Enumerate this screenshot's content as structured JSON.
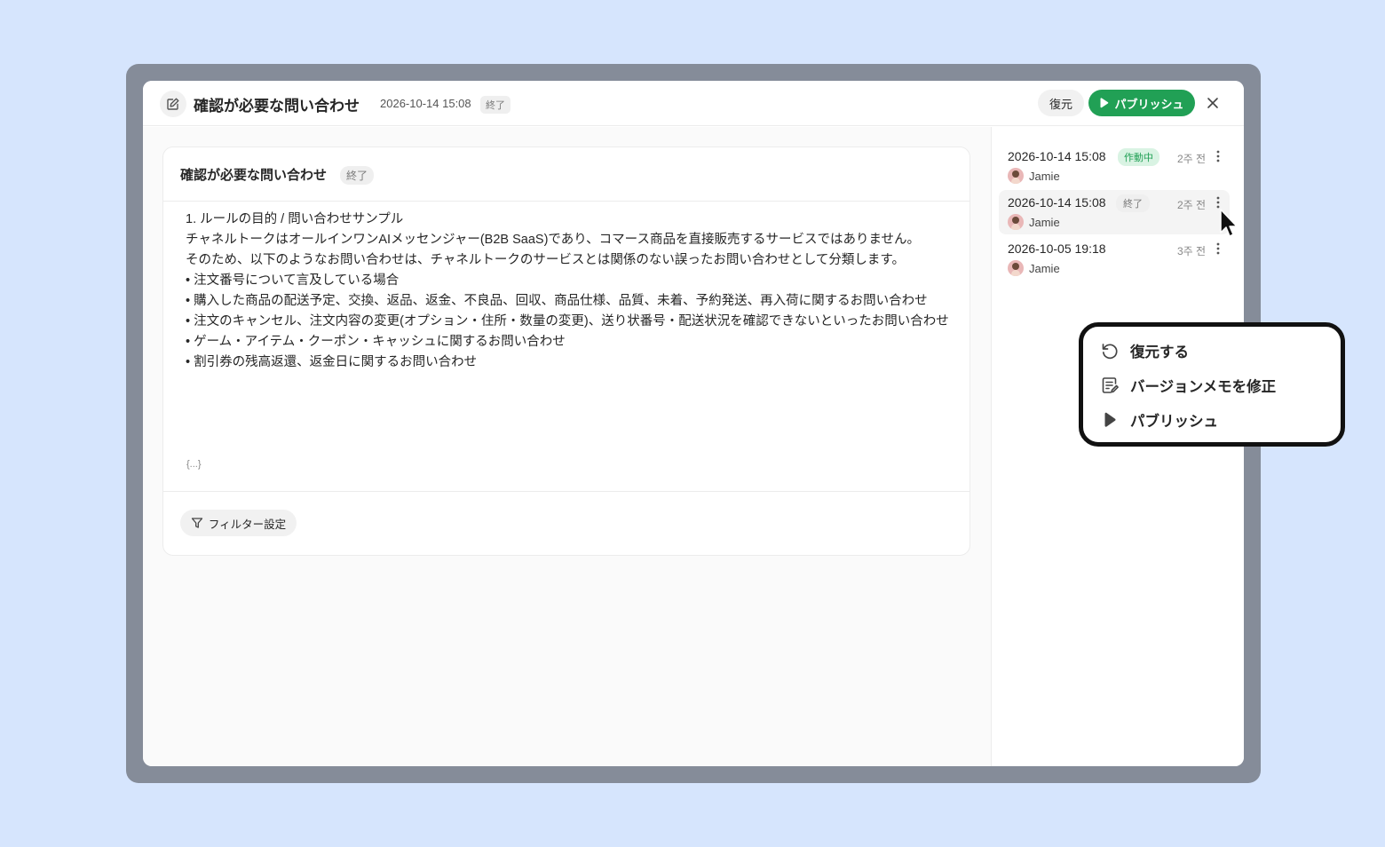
{
  "header": {
    "title": "確認が必要な問い合わせ",
    "date": "2026-10-14 15:08",
    "status": "終了",
    "restore_label": "復元",
    "publish_label": "パブリッシュ"
  },
  "card": {
    "title": "確認が必要な問い合わせ",
    "status": "終了",
    "lines": [
      "1. ルールの目的 / 問い合わせサンプル",
      "チャネルトークはオールインワンAIメッセンジャー(B2B SaaS)であり、コマース商品を直接販売するサービスではありません。",
      "そのため、以下のようなお問い合わせは、チャネルトークのサービスとは関係のない誤ったお問い合わせとして分類します。",
      "• 注文番号について言及している場合",
      "• 購入した商品の配送予定、交換、返品、返金、不良品、回収、商品仕様、品質、未着、予約発送、再入荷に関するお問い合わせ",
      "• 注文のキャンセル、注文内容の変更(オプション・住所・数量の変更)、送り状番号・配送状況を確認できないといったお問い合わせ",
      "• ゲーム・アイテム・クーポン・キャッシュに関するお問い合わせ",
      "• 割引券の残高返還、返金日に関するお問い合わせ"
    ],
    "more": "{...}",
    "filter_label": "フィルター設定"
  },
  "versions": [
    {
      "date": "2026-10-14 15:08",
      "badge": "作動中",
      "badge_type": "active",
      "ago": "2주 전",
      "user": "Jamie"
    },
    {
      "date": "2026-10-14 15:08",
      "badge": "終了",
      "badge_type": "ended",
      "ago": "2주 전",
      "user": "Jamie"
    },
    {
      "date": "2026-10-05 19:18",
      "badge": "",
      "badge_type": "none",
      "ago": "3주 전",
      "user": "Jamie"
    }
  ],
  "menu": {
    "items": [
      {
        "label": "復元する",
        "icon": "restore-icon"
      },
      {
        "label": "バージョンメモを修正",
        "icon": "edit-note-icon"
      },
      {
        "label": "パブリッシュ",
        "icon": "play-icon"
      }
    ]
  },
  "colors": {
    "background": "#d6e5fd",
    "frame": "#858c99",
    "accent_green": "#21a055"
  }
}
